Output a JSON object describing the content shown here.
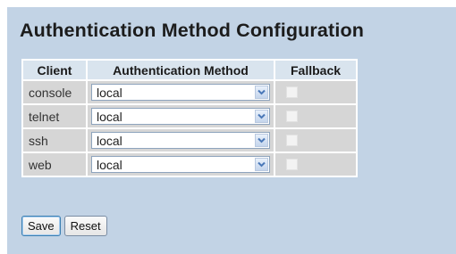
{
  "page": {
    "title": "Authentication Method Configuration"
  },
  "table": {
    "headers": {
      "client": "Client",
      "method": "Authentication Method",
      "fallback": "Fallback"
    },
    "rows": [
      {
        "client": "console",
        "method": "local",
        "fallback": false
      },
      {
        "client": "telnet",
        "method": "local",
        "fallback": false
      },
      {
        "client": "ssh",
        "method": "local",
        "fallback": false
      },
      {
        "client": "web",
        "method": "local",
        "fallback": false
      }
    ]
  },
  "buttons": {
    "save": "Save",
    "reset": "Reset"
  },
  "colors": {
    "panel_background": "#c2d3e5",
    "header_cell": "#d9e4ee",
    "data_cell": "#d6d6d6",
    "dropdown_arrow": "#4a78b8"
  },
  "icons": {
    "dropdown": "chevron-down-icon"
  }
}
